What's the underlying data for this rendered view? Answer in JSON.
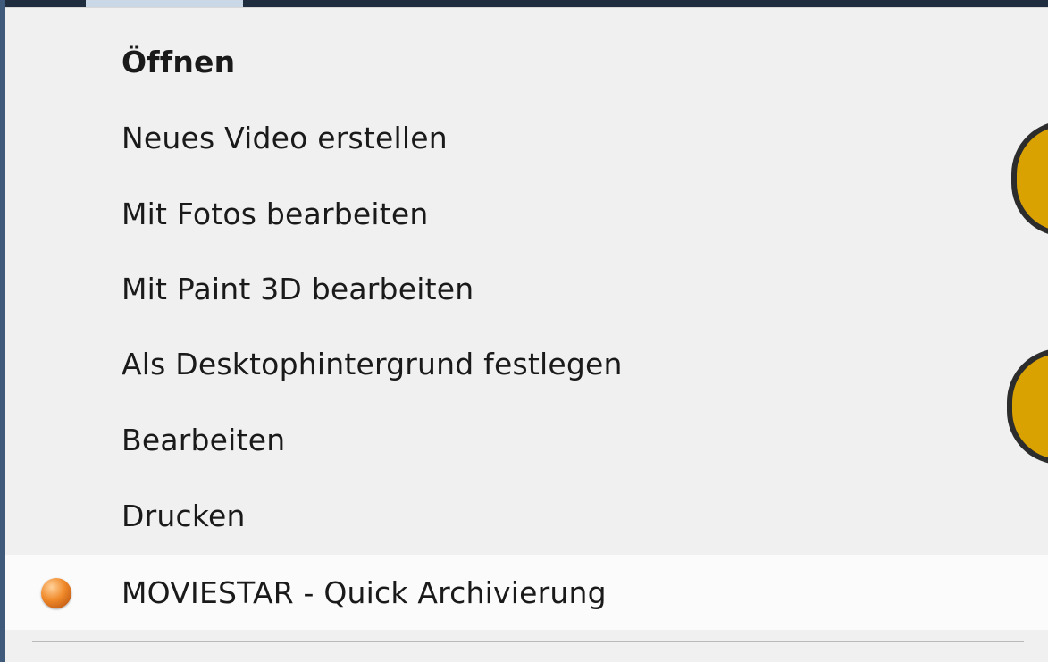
{
  "context_menu": {
    "items": [
      {
        "label": "Öffnen",
        "bold": true
      },
      {
        "label": "Neues Video erstellen"
      },
      {
        "label": "Mit Fotos bearbeiten"
      },
      {
        "label": "Mit Paint 3D bearbeiten"
      },
      {
        "label": "Als Desktophintergrund festlegen"
      },
      {
        "label": "Bearbeiten"
      },
      {
        "label": "Drucken"
      },
      {
        "label": "MOVIESTAR - Quick Archivierung",
        "icon": "moviestar-orb-icon",
        "highlighted": true
      }
    ]
  },
  "annotations": {
    "marker_color": "#d9a200"
  }
}
